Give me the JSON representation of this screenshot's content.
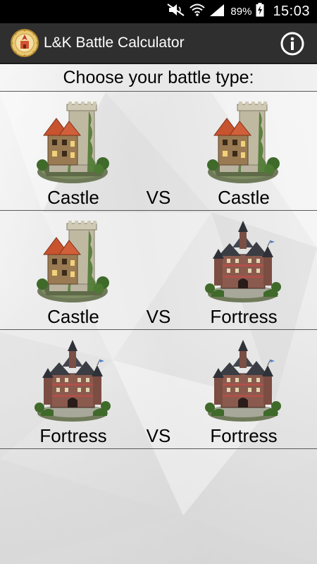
{
  "status_bar": {
    "battery_percent": "89%",
    "time": "15:03",
    "icons": [
      "mute-icon",
      "wifi-icon",
      "signal-icon",
      "battery-charging-icon"
    ]
  },
  "action_bar": {
    "title": "L&K Battle Calculator",
    "logo_icon": "crest-logo-icon",
    "info_icon": "info-icon"
  },
  "prompt": "Choose your battle type:",
  "battles": [
    {
      "left": "Castle",
      "vs": "VS",
      "right": "Castle",
      "left_icon": "castle-icon",
      "right_icon": "castle-icon"
    },
    {
      "left": "Castle",
      "vs": "VS",
      "right": "Fortress",
      "left_icon": "castle-icon",
      "right_icon": "fortress-icon"
    },
    {
      "left": "Fortress",
      "vs": "VS",
      "right": "Fortress",
      "left_icon": "fortress-icon",
      "right_icon": "fortress-icon"
    }
  ],
  "colors": {
    "status_bar": "#000000",
    "action_bar": "#2f2f2f",
    "divider": "#5a5a5a",
    "text": "#000000"
  }
}
